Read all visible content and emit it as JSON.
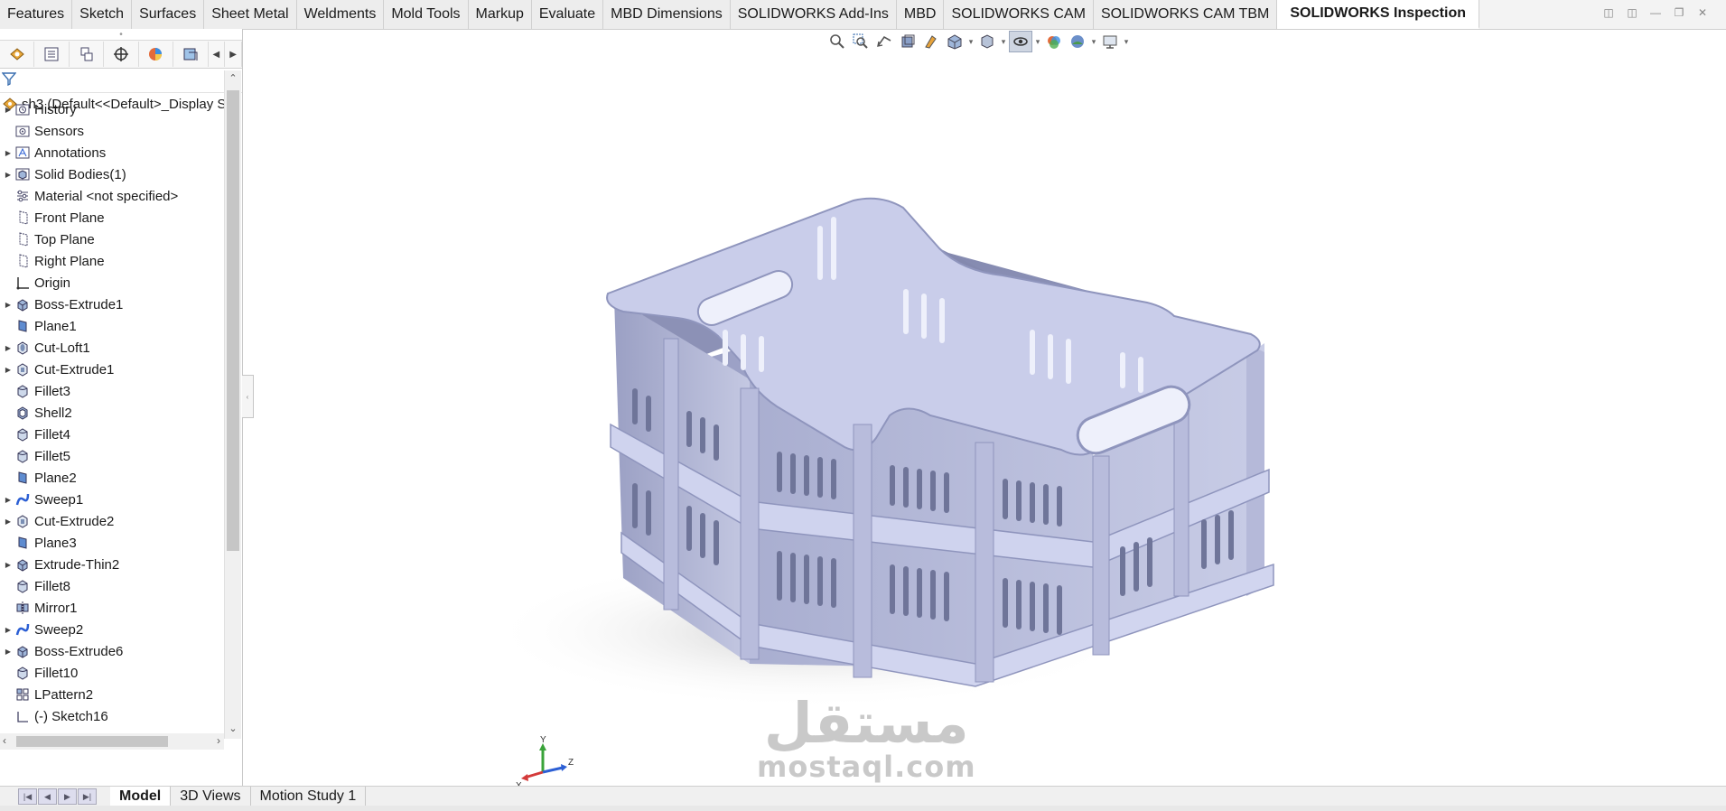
{
  "top_tabs": [
    {
      "label": "Features"
    },
    {
      "label": "Sketch"
    },
    {
      "label": "Surfaces"
    },
    {
      "label": "Sheet Metal"
    },
    {
      "label": "Weldments"
    },
    {
      "label": "Mold Tools"
    },
    {
      "label": "Markup"
    },
    {
      "label": "Evaluate"
    },
    {
      "label": "MBD Dimensions"
    },
    {
      "label": "SOLIDWORKS Add-Ins"
    },
    {
      "label": "MBD"
    },
    {
      "label": "SOLIDWORKS CAM"
    },
    {
      "label": "SOLIDWORKS CAM TBM"
    },
    {
      "label": "SOLIDWORKS Inspection",
      "active": true
    }
  ],
  "feature_tree": {
    "root_label": "sh3  (Default<<Default>_Display S",
    "items": [
      {
        "label": "History",
        "icon": "history-folder-icon",
        "expandable": true
      },
      {
        "label": "Sensors",
        "icon": "sensors-icon",
        "expandable": false
      },
      {
        "label": "Annotations",
        "icon": "annotations-icon",
        "expandable": true
      },
      {
        "label": "Solid Bodies(1)",
        "icon": "solid-bodies-icon",
        "expandable": true
      },
      {
        "label": "Material <not specified>",
        "icon": "material-icon",
        "expandable": false
      },
      {
        "label": "Front Plane",
        "icon": "plane-icon",
        "expandable": false
      },
      {
        "label": "Top Plane",
        "icon": "plane-icon",
        "expandable": false
      },
      {
        "label": "Right Plane",
        "icon": "plane-icon",
        "expandable": false
      },
      {
        "label": "Origin",
        "icon": "origin-icon",
        "expandable": false
      },
      {
        "label": "Boss-Extrude1",
        "icon": "extrude-icon",
        "expandable": true
      },
      {
        "label": "Plane1",
        "icon": "ref-plane-icon",
        "expandable": false
      },
      {
        "label": "Cut-Loft1",
        "icon": "cut-loft-icon",
        "expandable": true
      },
      {
        "label": "Cut-Extrude1",
        "icon": "cut-extrude-icon",
        "expandable": true
      },
      {
        "label": "Fillet3",
        "icon": "fillet-icon",
        "expandable": false
      },
      {
        "label": "Shell2",
        "icon": "shell-icon",
        "expandable": false
      },
      {
        "label": "Fillet4",
        "icon": "fillet-icon",
        "expandable": false
      },
      {
        "label": "Fillet5",
        "icon": "fillet-icon",
        "expandable": false
      },
      {
        "label": "Plane2",
        "icon": "ref-plane-icon",
        "expandable": false
      },
      {
        "label": "Sweep1",
        "icon": "sweep-icon",
        "expandable": true
      },
      {
        "label": "Cut-Extrude2",
        "icon": "cut-extrude-icon",
        "expandable": true
      },
      {
        "label": "Plane3",
        "icon": "ref-plane-icon",
        "expandable": false
      },
      {
        "label": "Extrude-Thin2",
        "icon": "extrude-icon",
        "expandable": true
      },
      {
        "label": "Fillet8",
        "icon": "fillet-icon",
        "expandable": false
      },
      {
        "label": "Mirror1",
        "icon": "mirror-icon",
        "expandable": false
      },
      {
        "label": "Sweep2",
        "icon": "sweep-icon",
        "expandable": true
      },
      {
        "label": "Boss-Extrude6",
        "icon": "extrude-icon",
        "expandable": true
      },
      {
        "label": "Fillet10",
        "icon": "fillet-icon",
        "expandable": false
      },
      {
        "label": "LPattern2",
        "icon": "linear-pattern-icon",
        "expandable": false
      },
      {
        "label": "(-) Sketch16",
        "icon": "sketch-icon",
        "expandable": false
      }
    ]
  },
  "bottom_tabs": [
    {
      "label": "Model",
      "active": true
    },
    {
      "label": "3D Views"
    },
    {
      "label": "Motion Study 1"
    }
  ],
  "triad": {
    "x": "X",
    "y": "Y",
    "z": "Z"
  },
  "watermark": {
    "arabic": "مستقل",
    "latin": "mostaql.com"
  },
  "colors": {
    "model": "#9ea3c6",
    "accent_tab": "#ffffff",
    "ribbon": "#f3f3f3"
  }
}
